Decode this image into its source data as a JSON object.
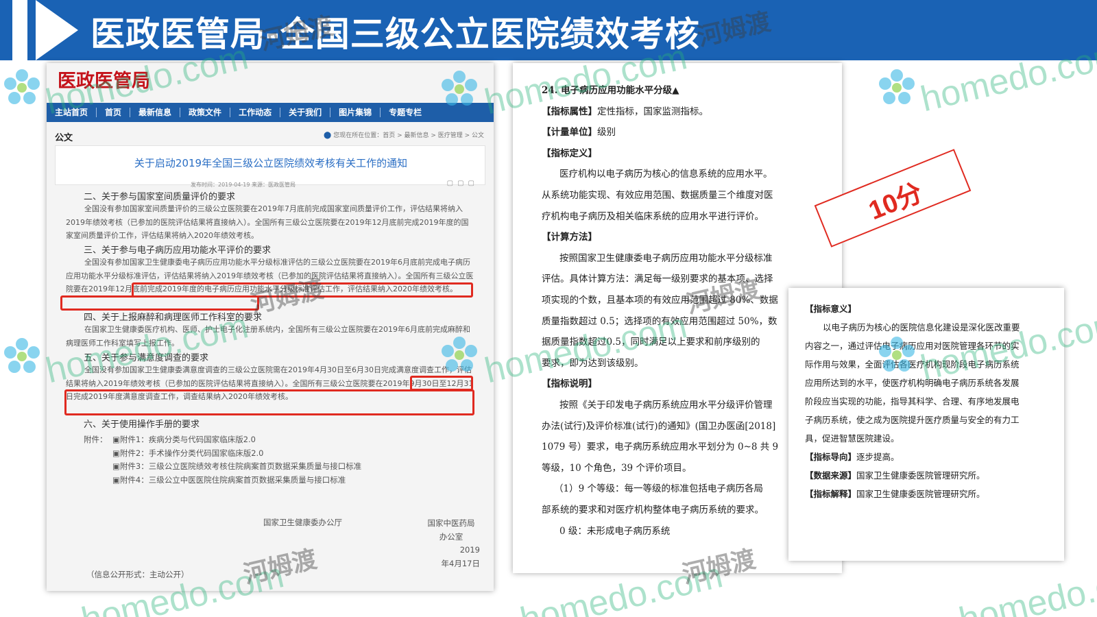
{
  "header": {
    "title": "医政医管局-全国三级公立医院绩效考核"
  },
  "watermark": {
    "latin": "homedo.com",
    "chinese": "河姆渡",
    "color": "#2bb47a"
  },
  "left_doc": {
    "site_name": "医政医管局",
    "nav": [
      "主站首页",
      "首页",
      "最新信息",
      "政策文件",
      "工作动态",
      "关于我们",
      "图片集锦",
      "专题专栏"
    ],
    "section_label": "公文",
    "breadcrumb": "您现在所在位置：首页 > 最新信息 > 医疗管理 > 公文",
    "notice_title": "关于启动2019年全国三级公立医院绩效考核有关工作的通知",
    "notice_meta": "发布时间：2019-04-19   来源：医政医管局",
    "sections": [
      {
        "heading": "二、关于参与国家室间质量评价的要求",
        "text": "全国没有参加国家室间质量评价的三级公立医院要在2019年7月底前完成国家室间质量评价工作，评估结果将纳入2019年绩效考核（已参加的医院评估结果将直接纳入）。全国所有三级公立医院要在2019年12月底前完成2019年度的国家室间质量评价工作，评估结果将纳入2020年绩效考核。"
      },
      {
        "heading": "三、关于参与电子病历应用功能水平评价的要求",
        "text": "全国没有参加国家卫生健康委电子病历应用功能水平分级标准评估的三级公立医院要在2019年6月底前完成电子病历应用功能水平分级标准评估，评估结果将纳入2019年绩效考核（已参加的医院评估结果将直接纳入）。全国所有三级公立医院要在2019年12月底前完成2019年度的电子病历应用功能水平分级标准评估工作，评估结果纳入2020年绩效考核。"
      },
      {
        "heading": "四、关于上报麻醉和病理医师工作科室的要求",
        "text": "在国家卫生健康委医疗机构、医师、护士电子化注册系统内，全国所有三级公立医院要在2019年6月底前完成麻醉和病理医师工作科室填写上报工作。"
      },
      {
        "heading": "五、关于参与满意度调查的要求",
        "text": "全国没有参加国家卫生健康委满意度调查的三级公立医院需在2019年4月30日至6月30日完成满意度调查工作，评估结果将纳入2019年绩效考核（已参加的医院评估结果将直接纳入）。全国所有三级公立医院要在2019年9月30日至12月31日完成2019年度满意度调查工作，调查结果纳入2020年绩效考核。"
      },
      {
        "heading": "六、关于使用操作手册的要求",
        "text": ""
      }
    ],
    "attachments_label": "附件：",
    "attachments": [
      "附件1：疾病分类与代码国家临床版2.0",
      "附件2：手术操作分类代码国家临床版2.0",
      "附件3：三级公立医院绩效考核住院病案首页数据采集质量与接口标准",
      "附件4：三级公立中医医院住院病案首页数据采集质量与接口标准"
    ],
    "signature_left": "国家卫生健康委办公厅",
    "signature_right": [
      "国家中医药局",
      "办公室",
      "2019",
      "年4月17日"
    ],
    "publish_form": "（信息公开形式：主动公开）"
  },
  "mid_doc": {
    "lines": [
      {
        "style": "bold",
        "text": "24. 电子病历应用功能水平分级▲"
      },
      {
        "style": "label",
        "label": "【指标属性】",
        "text": "定性指标，国家监测指标。"
      },
      {
        "style": "label",
        "label": "【计量单位】",
        "text": "级别"
      },
      {
        "style": "label",
        "label": "【指标定义】",
        "text": ""
      },
      {
        "style": "indent",
        "text": "医疗机构以电子病历为核心的信息系统的应用水平。"
      },
      {
        "style": "plain",
        "text": "从系统功能实现、有效应用范围、数据质量三个维度对医"
      },
      {
        "style": "plain",
        "text": "疗机构电子病历及相关临床系统的应用水平进行评价。"
      },
      {
        "style": "label",
        "label": "【计算方法】",
        "text": ""
      },
      {
        "style": "indent",
        "text": "按照国家卫生健康委电子病历应用功能水平分级标准"
      },
      {
        "style": "plain",
        "text": "评估。具体计算方法：满足每一级别要求的基本项、选择"
      },
      {
        "style": "plain",
        "text": "项实现的个数，且基本项的有效应用范围超过 80%、数据"
      },
      {
        "style": "plain",
        "text": "质量指数超过 0.5；选择项的有效应用范围超过 50%，数"
      },
      {
        "style": "plain",
        "text": "据质量指数超过0.5，同时满足以上要求和前序级别的"
      },
      {
        "style": "plain",
        "text": "要求，即为达到该级别。"
      },
      {
        "style": "label",
        "label": "【指标说明】",
        "text": ""
      },
      {
        "style": "indent",
        "text": "按照《关于印发电子病历系统应用水平分级评价管理"
      },
      {
        "style": "plain",
        "text": "办法(试行)及评价标准(试行)的通知》(国卫办医函[2018]"
      },
      {
        "style": "plain",
        "text": "1079 号）要求，电子病历系统应用水平划分为 0~8 共 9"
      },
      {
        "style": "plain",
        "text": "等级，10 个角色，39 个评价项目。"
      },
      {
        "style": "indent2",
        "text": "（1）9 个等级：每一等级的标准包括电子病历各局"
      },
      {
        "style": "plain",
        "text": "部系统的要求和对医疗机构整体电子病历系统的要求。"
      },
      {
        "style": "indent",
        "text": "0 级：未形成电子病历系统"
      }
    ]
  },
  "score_badge": {
    "text": "10分",
    "color": "#e02a20"
  },
  "right_doc": {
    "lines": [
      {
        "style": "label",
        "label": "【指标意义】",
        "text": ""
      },
      {
        "style": "indent",
        "text": "以电子病历为核心的医院信息化建设是深化医改重要"
      },
      {
        "style": "plain",
        "text": "内容之一，通过评估电子病历应用对医院管理各环节的实"
      },
      {
        "style": "plain",
        "text": "际作用与效果，全面评估各医疗机构现阶段电子病历系统"
      },
      {
        "style": "plain",
        "text": "应用所达到的水平，使医疗机构明确电子病历系统各发展"
      },
      {
        "style": "plain",
        "text": "阶段应当实现的功能，指导其科学、合理、有序地发展电"
      },
      {
        "style": "plain",
        "text": "子病历系统，使之成为医院提升医疗质量与安全的有力工"
      },
      {
        "style": "plain",
        "text": "具，促进智慧医院建设。"
      },
      {
        "style": "label",
        "label": "【指标导向】",
        "text": "逐步提高。"
      },
      {
        "style": "label",
        "label": "【数据来源】",
        "text": "国家卫生健康委医院管理研究所。"
      },
      {
        "style": "label",
        "label": "【指标解释】",
        "text": "国家卫生健康委医院管理研究所。"
      }
    ]
  }
}
